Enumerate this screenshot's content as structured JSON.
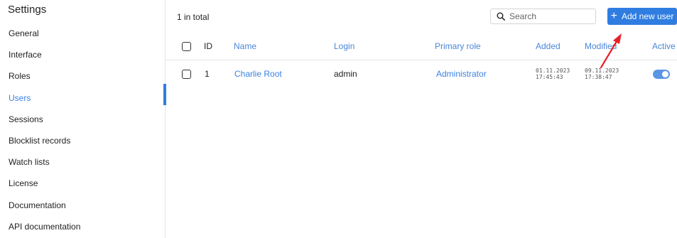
{
  "sidebar": {
    "title": "Settings",
    "items": [
      {
        "label": "General"
      },
      {
        "label": "Interface"
      },
      {
        "label": "Roles"
      },
      {
        "label": "Users"
      },
      {
        "label": "Sessions"
      },
      {
        "label": "Blocklist records"
      },
      {
        "label": "Watch lists"
      },
      {
        "label": "License"
      },
      {
        "label": "Documentation"
      },
      {
        "label": "API documentation"
      }
    ],
    "active": "Users"
  },
  "toolbar": {
    "total": "1 in total",
    "search_placeholder": "Search",
    "add_button_label": "Add new user",
    "accent_color": "#2f7de1"
  },
  "table": {
    "columns": {
      "id": "ID",
      "name": "Name",
      "login": "Login",
      "role": "Primary role",
      "added": "Added",
      "modified": "Modified",
      "active": "Active"
    },
    "rows": [
      {
        "id": "1",
        "name": "Charlie Root",
        "login": "admin",
        "role": "Administrator",
        "added_date": "01.11.2023",
        "added_time": "17:45:43",
        "modified_date": "09.11.2023",
        "modified_time": "17:38:47",
        "active": true
      }
    ]
  },
  "annotation": {
    "arrow_color": "#e8202a"
  }
}
